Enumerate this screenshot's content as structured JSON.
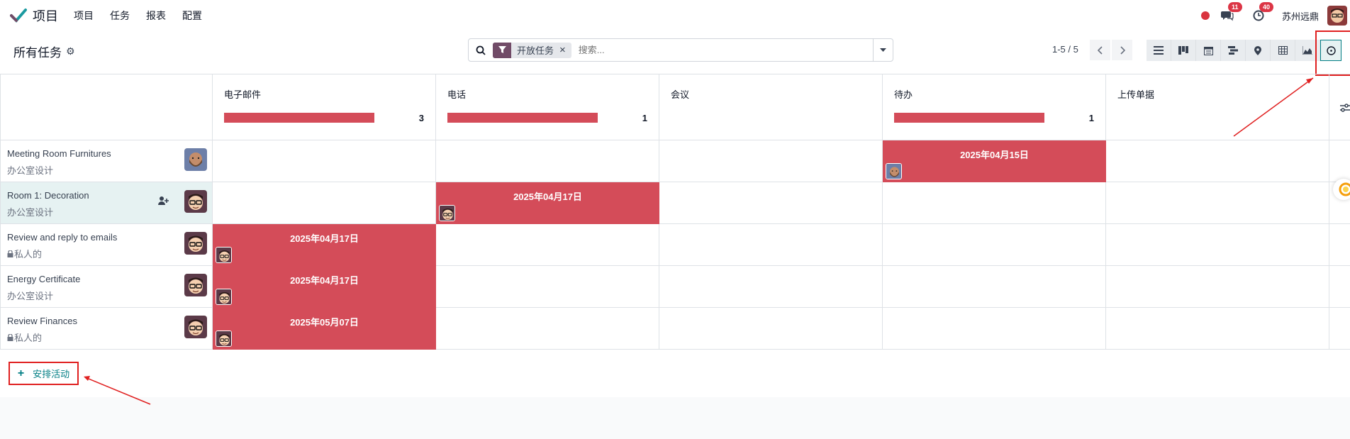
{
  "navbar": {
    "app_name": "项目",
    "menu": [
      "项目",
      "任务",
      "报表",
      "配置"
    ],
    "messages_badge": "11",
    "activities_badge": "40",
    "company": "苏州远鼎"
  },
  "control_panel": {
    "title": "所有任务",
    "facet_label": "开放任务",
    "search_placeholder": "搜索...",
    "pager": "1-5 / 5"
  },
  "columns": [
    {
      "label": "电子邮件",
      "count": "3",
      "has_bar": true
    },
    {
      "label": "电话",
      "count": "1",
      "has_bar": true
    },
    {
      "label": "会议",
      "count": "",
      "has_bar": false
    },
    {
      "label": "待办",
      "count": "1",
      "has_bar": true
    },
    {
      "label": "上传单据",
      "count": "",
      "has_bar": false
    }
  ],
  "rows": [
    {
      "name": "Meeting Room Furnitures",
      "project": "办公室设计",
      "private": false
    },
    {
      "name": "Room 1: Decoration",
      "project": "办公室设计",
      "private": false
    },
    {
      "name": "Review and reply to emails",
      "project": "私人的",
      "private": true
    },
    {
      "name": "Energy Certificate",
      "project": "办公室设计",
      "private": false
    },
    {
      "name": "Review Finances",
      "project": "私人的",
      "private": true
    }
  ],
  "activities": [
    {
      "row": 0,
      "col": 3,
      "date": "2025年04月15日"
    },
    {
      "row": 1,
      "col": 1,
      "date": "2025年04月17日"
    },
    {
      "row": 2,
      "col": 0,
      "date": "2025年04月17日"
    },
    {
      "row": 3,
      "col": 0,
      "date": "2025年04月17日"
    },
    {
      "row": 4,
      "col": 0,
      "date": "2025年05月07日"
    }
  ],
  "actions": {
    "schedule_activity": "安排活动"
  },
  "colors": {
    "activity_overdue": "#d44c59",
    "accent": "#017e84",
    "brand": "#714b67",
    "highlight": "#e02020"
  }
}
